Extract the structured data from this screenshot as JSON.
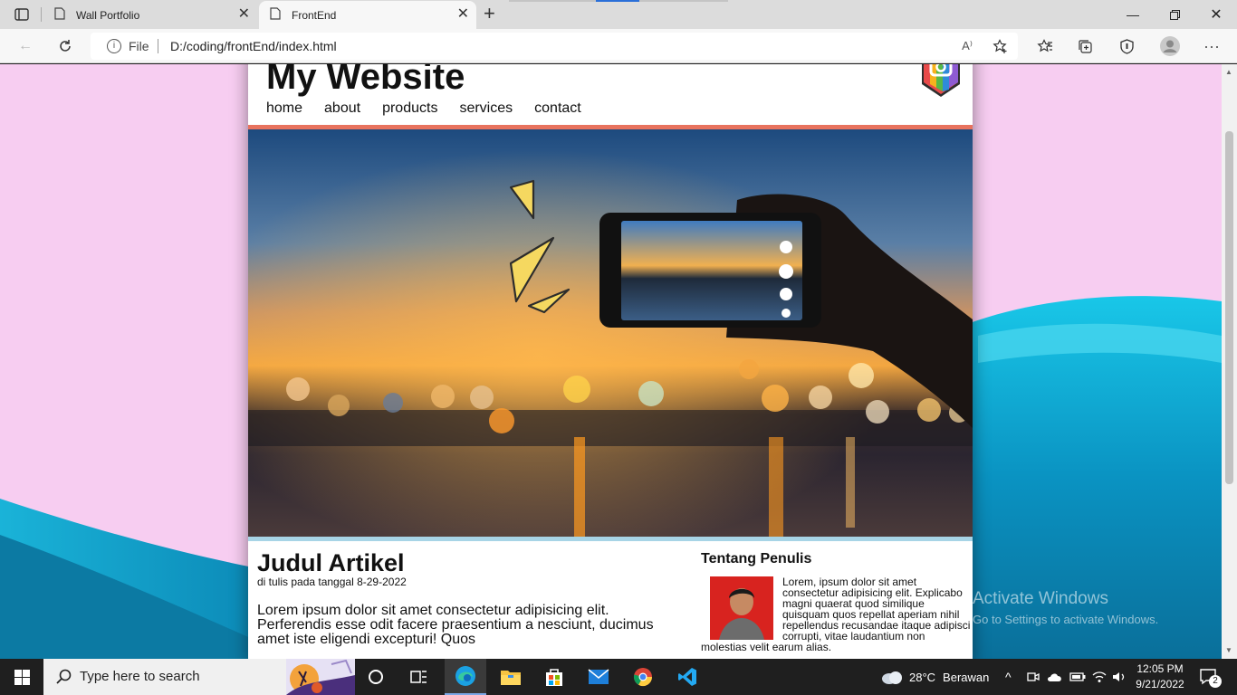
{
  "browser": {
    "tabs": [
      {
        "label": "Wall Portfolio",
        "active": false
      },
      {
        "label": "FrontEnd",
        "active": true
      }
    ],
    "address": {
      "file_label": "File",
      "url": "D:/coding/frontEnd/index.html"
    }
  },
  "site": {
    "title": "My Website",
    "nav": [
      "home",
      "about",
      "products",
      "services",
      "contact"
    ],
    "article": {
      "title": "Judul Artikel",
      "date": "di tulis pada tanggal 8-29-2022",
      "body": "Lorem ipsum dolor sit amet consectetur adipisicing elit. Perferendis esse odit facere praesentium a nesciunt, ducimus amet iste eligendi excepturi! Quos"
    },
    "aside": {
      "title": "Tentang Penulis",
      "bio": "Lorem, ipsum dolor sit amet consectetur adipisicing elit. Explicabo magni quaerat quod similique quisquam quos repellat aperiam nihil repellendus recusandae itaque adipisci corrupti, vitae laudantium non molestias velit earum alias."
    },
    "colors": {
      "header_rule": "#e8735e",
      "hero_rule": "#a7d4e6",
      "background": "#f7cdf1"
    }
  },
  "watermark": {
    "line1": "Activate Windows",
    "line2": "Go to Settings to activate Windows."
  },
  "taskbar": {
    "search_placeholder": "Type here to search",
    "apps": [
      "cortana-icon",
      "task-view-icon",
      "edge-icon",
      "file-explorer-icon",
      "store-icon",
      "mail-icon",
      "chrome-icon",
      "vscode-icon"
    ],
    "weather": {
      "temp": "28°C",
      "condition": "Berawan"
    },
    "time": "12:05 PM",
    "date": "9/21/2022",
    "notifications": "2"
  }
}
